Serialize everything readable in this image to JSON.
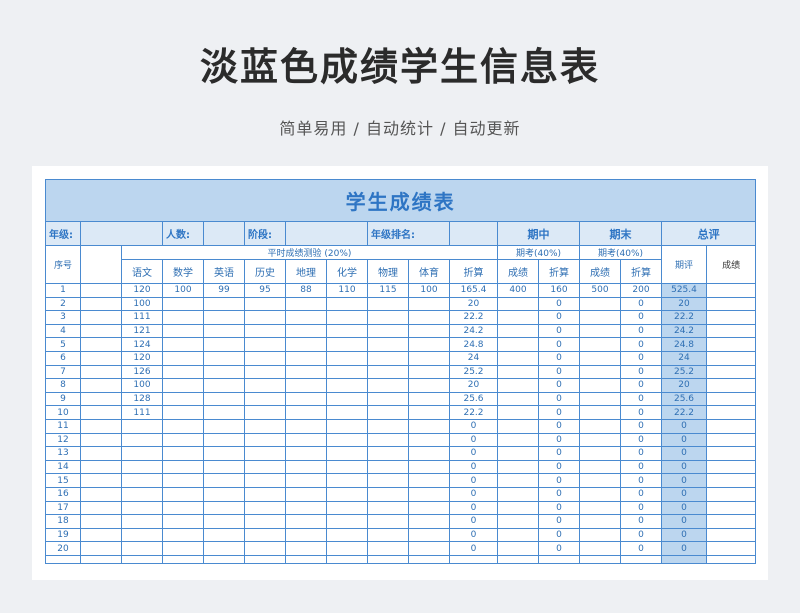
{
  "title": "淡蓝色成绩学生信息表",
  "subtitle": "简单易用 / 自动统计 / 自动更新",
  "sheet": {
    "header_title": "学生成绩表",
    "info": {
      "grade": "年级:",
      "count": "人数:",
      "stage": "阶段:",
      "rank": "年级排名:",
      "midterm": "期中",
      "final": "期末",
      "total": "总评"
    },
    "columns": {
      "index": "序号",
      "usual_group": "平时成绩测验 (20%)",
      "exam_mid": "期考(40%)",
      "exam_final": "期考(40%)",
      "subjects": [
        "语文",
        "数学",
        "英语",
        "历史",
        "地理",
        "化学",
        "物理",
        "体育"
      ],
      "discount": "折算",
      "score": "成绩",
      "mid_discount": "折算",
      "final_score": "成绩",
      "final_discount": "折算",
      "period_eval": "期评",
      "total_score": "成绩"
    },
    "rows": [
      {
        "n": "1",
        "s": [
          "120",
          "100",
          "99",
          "95",
          "88",
          "110",
          "115",
          "100"
        ],
        "z": "165.4",
        "ms": "400",
        "mz": "160",
        "fs": "500",
        "fz": "200",
        "p": "525.4"
      },
      {
        "n": "2",
        "s": [
          "100",
          "",
          "",
          "",
          "",
          "",
          "",
          ""
        ],
        "z": "20",
        "ms": "",
        "mz": "0",
        "fs": "",
        "fz": "0",
        "p": "20"
      },
      {
        "n": "3",
        "s": [
          "111",
          "",
          "",
          "",
          "",
          "",
          "",
          ""
        ],
        "z": "22.2",
        "ms": "",
        "mz": "0",
        "fs": "",
        "fz": "0",
        "p": "22.2"
      },
      {
        "n": "4",
        "s": [
          "121",
          "",
          "",
          "",
          "",
          "",
          "",
          ""
        ],
        "z": "24.2",
        "ms": "",
        "mz": "0",
        "fs": "",
        "fz": "0",
        "p": "24.2"
      },
      {
        "n": "5",
        "s": [
          "124",
          "",
          "",
          "",
          "",
          "",
          "",
          ""
        ],
        "z": "24.8",
        "ms": "",
        "mz": "0",
        "fs": "",
        "fz": "0",
        "p": "24.8"
      },
      {
        "n": "6",
        "s": [
          "120",
          "",
          "",
          "",
          "",
          "",
          "",
          ""
        ],
        "z": "24",
        "ms": "",
        "mz": "0",
        "fs": "",
        "fz": "0",
        "p": "24"
      },
      {
        "n": "7",
        "s": [
          "126",
          "",
          "",
          "",
          "",
          "",
          "",
          ""
        ],
        "z": "25.2",
        "ms": "",
        "mz": "0",
        "fs": "",
        "fz": "0",
        "p": "25.2"
      },
      {
        "n": "8",
        "s": [
          "100",
          "",
          "",
          "",
          "",
          "",
          "",
          ""
        ],
        "z": "20",
        "ms": "",
        "mz": "0",
        "fs": "",
        "fz": "0",
        "p": "20"
      },
      {
        "n": "9",
        "s": [
          "128",
          "",
          "",
          "",
          "",
          "",
          "",
          ""
        ],
        "z": "25.6",
        "ms": "",
        "mz": "0",
        "fs": "",
        "fz": "0",
        "p": "25.6"
      },
      {
        "n": "10",
        "s": [
          "111",
          "",
          "",
          "",
          "",
          "",
          "",
          ""
        ],
        "z": "22.2",
        "ms": "",
        "mz": "0",
        "fs": "",
        "fz": "0",
        "p": "22.2"
      },
      {
        "n": "11",
        "s": [
          "",
          "",
          "",
          "",
          "",
          "",
          "",
          ""
        ],
        "z": "0",
        "ms": "",
        "mz": "0",
        "fs": "",
        "fz": "0",
        "p": "0"
      },
      {
        "n": "12",
        "s": [
          "",
          "",
          "",
          "",
          "",
          "",
          "",
          ""
        ],
        "z": "0",
        "ms": "",
        "mz": "0",
        "fs": "",
        "fz": "0",
        "p": "0"
      },
      {
        "n": "13",
        "s": [
          "",
          "",
          "",
          "",
          "",
          "",
          "",
          ""
        ],
        "z": "0",
        "ms": "",
        "mz": "0",
        "fs": "",
        "fz": "0",
        "p": "0"
      },
      {
        "n": "14",
        "s": [
          "",
          "",
          "",
          "",
          "",
          "",
          "",
          ""
        ],
        "z": "0",
        "ms": "",
        "mz": "0",
        "fs": "",
        "fz": "0",
        "p": "0"
      },
      {
        "n": "15",
        "s": [
          "",
          "",
          "",
          "",
          "",
          "",
          "",
          ""
        ],
        "z": "0",
        "ms": "",
        "mz": "0",
        "fs": "",
        "fz": "0",
        "p": "0"
      },
      {
        "n": "16",
        "s": [
          "",
          "",
          "",
          "",
          "",
          "",
          "",
          ""
        ],
        "z": "0",
        "ms": "",
        "mz": "0",
        "fs": "",
        "fz": "0",
        "p": "0"
      },
      {
        "n": "17",
        "s": [
          "",
          "",
          "",
          "",
          "",
          "",
          "",
          ""
        ],
        "z": "0",
        "ms": "",
        "mz": "0",
        "fs": "",
        "fz": "0",
        "p": "0"
      },
      {
        "n": "18",
        "s": [
          "",
          "",
          "",
          "",
          "",
          "",
          "",
          ""
        ],
        "z": "0",
        "ms": "",
        "mz": "0",
        "fs": "",
        "fz": "0",
        "p": "0"
      },
      {
        "n": "19",
        "s": [
          "",
          "",
          "",
          "",
          "",
          "",
          "",
          ""
        ],
        "z": "0",
        "ms": "",
        "mz": "0",
        "fs": "",
        "fz": "0",
        "p": "0"
      },
      {
        "n": "20",
        "s": [
          "",
          "",
          "",
          "",
          "",
          "",
          "",
          ""
        ],
        "z": "0",
        "ms": "",
        "mz": "0",
        "fs": "",
        "fz": "0",
        "p": "0"
      }
    ]
  },
  "colors": {
    "header_fill": "#bcd6ef",
    "info_fill": "#dce9f6",
    "border": "#4a8ad0",
    "text": "#2f6fb3",
    "title_text": "#2e75c4",
    "page_background": "#eef0f3"
  }
}
